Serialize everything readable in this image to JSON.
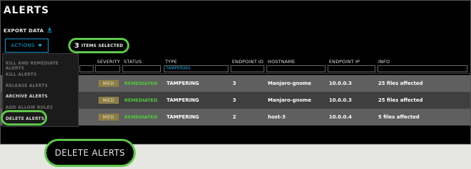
{
  "page": {
    "title": "ALERTS"
  },
  "toolbar": {
    "export_label": "EXPORT DATA",
    "actions_label": "ACTIONS",
    "selected_count": "3",
    "selected_label": "ITEMS SELECTED"
  },
  "table": {
    "headers": {
      "severity": "SEVERITY",
      "status": "STATUS",
      "type": "TYPE",
      "endpoint_id": "ENDPOINT ID",
      "hostname": "HOSTNAME",
      "endpoint_ip": "ENDPOINT IP",
      "info": "INFO"
    },
    "filters": {
      "type": "TAMPERING"
    },
    "rows": [
      {
        "severity": "MED",
        "status": "REMEDIATED",
        "type": "TAMPERING",
        "endpoint_id": "3",
        "hostname": "Manjaro-gnome",
        "endpoint_ip": "10.0.0.3",
        "info": "25 files affected"
      },
      {
        "severity": "MED",
        "status": "REMEDIATED",
        "type": "TAMPERING",
        "endpoint_id": "3",
        "hostname": "Manjaro-gnome",
        "endpoint_ip": "10.0.0.3",
        "info": "25 files affected"
      },
      {
        "severity": "MED",
        "status": "REMEDIATED",
        "type": "TAMPERING",
        "endpoint_id": "2",
        "hostname": "host-3",
        "endpoint_ip": "10.0.0.4",
        "info": "5 files affected"
      }
    ]
  },
  "actions_menu": {
    "items": [
      {
        "label": "KILL AND REMEDIATE ALERTS",
        "enabled": false
      },
      {
        "label": "KILL ALERTS",
        "enabled": false
      },
      {
        "label": "RELEASE ALERTS",
        "enabled": false
      },
      {
        "label": "ARCHIVE ALERTS",
        "enabled": true
      },
      {
        "label": "ADD ALLOW RULES",
        "enabled": false
      },
      {
        "label": "DELETE ALERTS",
        "enabled": true
      }
    ]
  },
  "callout": {
    "label": "DELETE ALERTS"
  },
  "colors": {
    "accent_blue": "#1ea7d6",
    "highlight_green": "#5ec84a",
    "status_green": "#4ecb3b",
    "severity_med": "#8b7d4a"
  }
}
